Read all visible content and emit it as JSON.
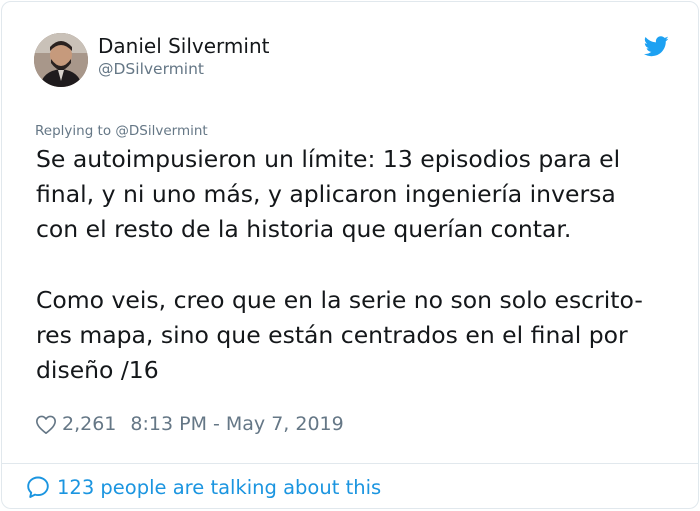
{
  "author": {
    "name": "Daniel Silvermint",
    "handle": "@DSilvermint"
  },
  "reply_context": "Replying to @DSilvermint",
  "tweet": {
    "lines_paragraph_1": [
      "Se autoimpusieron un límite: 13 episodios para el",
      "final, y ni uno más, y aplicaron ingeniería inversa",
      "con el resto de la historia que querían contar."
    ],
    "lines_paragraph_2": [
      "Como veis, creo que en la serie no son solo escrito-",
      "res mapa, sino que están centrados en el final por",
      "diseño /16"
    ]
  },
  "stats": {
    "likes": "2,261",
    "timestamp": "8:13 PM - May 7, 2019"
  },
  "footer": {
    "talking_label": "123 people are talking about this"
  },
  "icons": {
    "brand": "twitter-bird-icon",
    "like": "heart-outline-icon",
    "conversation": "speech-bubble-icon"
  },
  "colors": {
    "twitter_blue": "#1da1f2",
    "link_blue": "#1b95e0",
    "secondary_text": "#657786",
    "primary_text": "#14171a",
    "border": "#e1e8ed"
  }
}
